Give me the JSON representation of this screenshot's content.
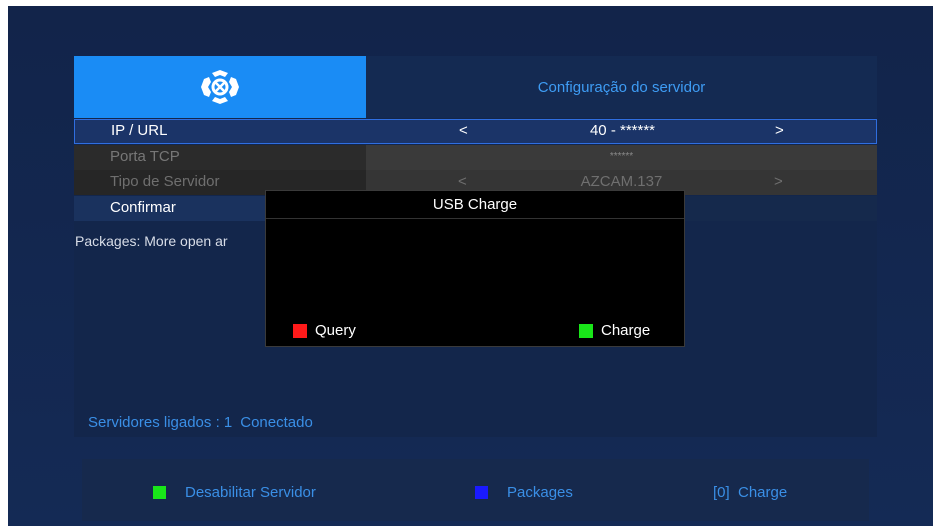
{
  "header": {
    "logo_icon": "receiver-logo-icon",
    "title": "Configuração do servidor"
  },
  "rows": [
    {
      "label": "IP / URL",
      "left_arrow": "<",
      "value": "40 - ******",
      "right_arrow": ">"
    },
    {
      "label": "Porta TCP",
      "value": "******"
    },
    {
      "label": "Tipo de Servidor",
      "left_arrow": "<",
      "value": "AZCAM.137",
      "right_arrow": ">"
    },
    {
      "label": "Confirmar"
    }
  ],
  "packages_text": "Packages: More open ar",
  "status": {
    "label": "Servidores ligados : 1",
    "state": "Conectado"
  },
  "dialog": {
    "title": "USB Charge",
    "query_label": "Query",
    "charge_label": "Charge"
  },
  "footer": {
    "disable_label": "Desabilitar Servidor",
    "packages_label": "Packages",
    "charge_label": "[0]  Charge"
  },
  "colors": {
    "accent_blue": "#1a8cf5",
    "title_text": "#3e9cf4",
    "red_key": "#ff1a1a",
    "green_key": "#19e619",
    "blue_key": "#1a1aff"
  }
}
